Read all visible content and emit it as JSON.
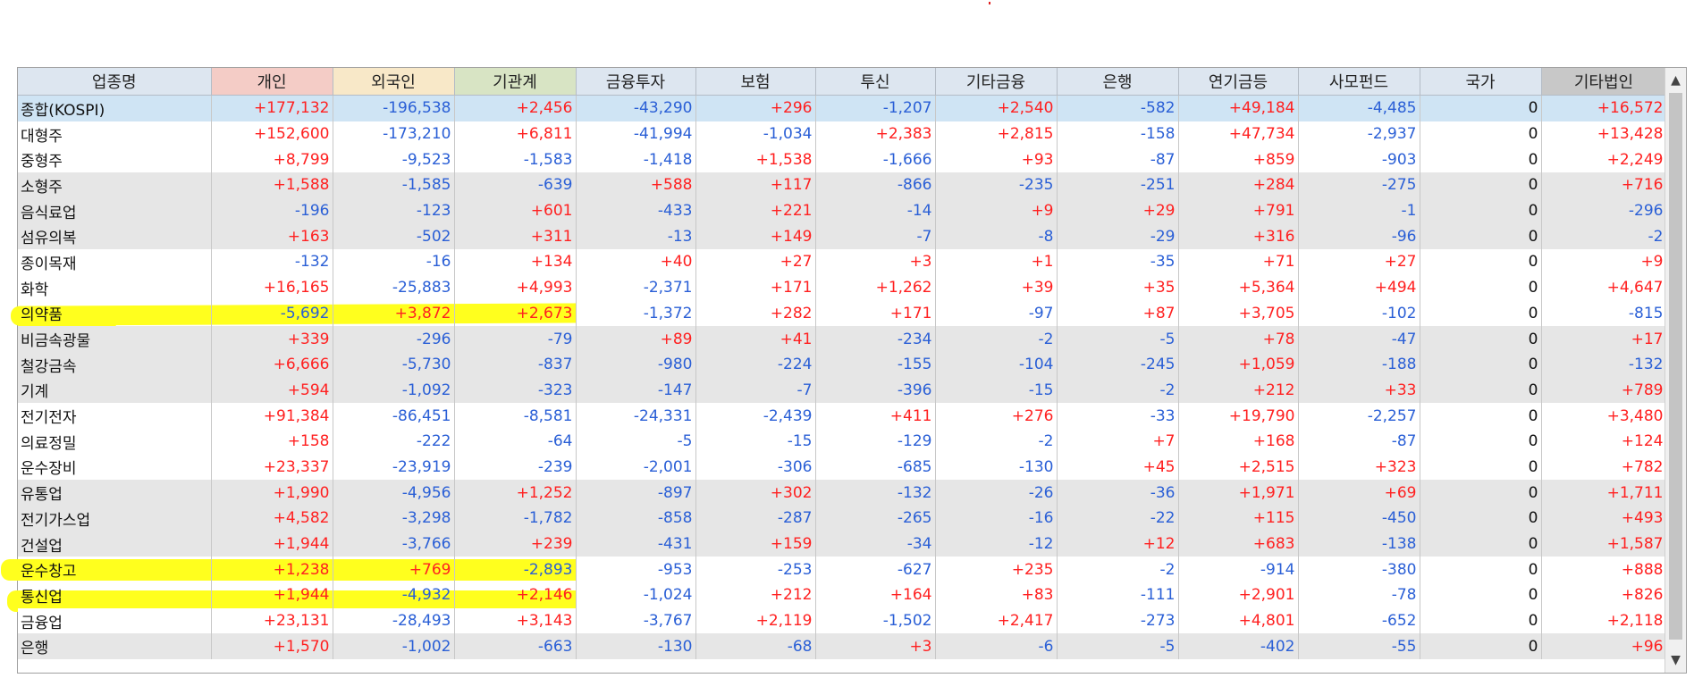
{
  "headers": [
    "업종명",
    "개인",
    "외국인",
    "기관계",
    "금융투자",
    "보험",
    "투신",
    "기타금융",
    "은행",
    "연기금등",
    "사모펀드",
    "국가",
    "기타법인"
  ],
  "header_colors": [
    "#dde6f0",
    "#f4ccc6",
    "#f8e8c8",
    "#d8e4c4",
    "#dde6f0",
    "#dde6f0",
    "#dde6f0",
    "#dde6f0",
    "#dde6f0",
    "#dde6f0",
    "#dde6f0",
    "#dde6f0",
    "#c8c8c8"
  ],
  "rows": [
    {
      "name": "종합(KOSPI)",
      "values": [
        "+177,132",
        "-196,538",
        "+2,456",
        "-43,290",
        "+296",
        "-1,207",
        "+2,540",
        "-582",
        "+49,184",
        "-4,485",
        "0",
        "+16,572"
      ]
    },
    {
      "name": "대형주",
      "values": [
        "+152,600",
        "-173,210",
        "+6,811",
        "-41,994",
        "-1,034",
        "+2,383",
        "+2,815",
        "-158",
        "+47,734",
        "-2,937",
        "0",
        "+13,428"
      ]
    },
    {
      "name": "중형주",
      "values": [
        "+8,799",
        "-9,523",
        "-1,583",
        "-1,418",
        "+1,538",
        "-1,666",
        "+93",
        "-87",
        "+859",
        "-903",
        "0",
        "+2,249"
      ]
    },
    {
      "name": "소형주",
      "values": [
        "+1,588",
        "-1,585",
        "-639",
        "+588",
        "+117",
        "-866",
        "-235",
        "-251",
        "+284",
        "-275",
        "0",
        "+716"
      ]
    },
    {
      "name": "음식료업",
      "values": [
        "-196",
        "-123",
        "+601",
        "-433",
        "+221",
        "-14",
        "+9",
        "+29",
        "+791",
        "-1",
        "0",
        "-296"
      ]
    },
    {
      "name": "섬유의복",
      "values": [
        "+163",
        "-502",
        "+311",
        "-13",
        "+149",
        "-7",
        "-8",
        "-29",
        "+316",
        "-96",
        "0",
        "-2"
      ]
    },
    {
      "name": "종이목재",
      "values": [
        "-132",
        "-16",
        "+134",
        "+40",
        "+27",
        "+3",
        "+1",
        "-35",
        "+71",
        "+27",
        "0",
        "+9"
      ]
    },
    {
      "name": "화학",
      "values": [
        "+16,165",
        "-25,883",
        "+4,993",
        "-2,371",
        "+171",
        "+1,262",
        "+39",
        "+35",
        "+5,364",
        "+494",
        "0",
        "+4,647"
      ]
    },
    {
      "name": "의약품",
      "values": [
        "-5,692",
        "+3,872",
        "+2,673",
        "-1,372",
        "+282",
        "+171",
        "-97",
        "+87",
        "+3,705",
        "-102",
        "0",
        "-815"
      ]
    },
    {
      "name": "비금속광물",
      "values": [
        "+339",
        "-296",
        "-79",
        "+89",
        "+41",
        "-234",
        "-2",
        "-5",
        "+78",
        "-47",
        "0",
        "+17"
      ]
    },
    {
      "name": "철강금속",
      "values": [
        "+6,666",
        "-5,730",
        "-837",
        "-980",
        "-224",
        "-155",
        "-104",
        "-245",
        "+1,059",
        "-188",
        "0",
        "-132"
      ]
    },
    {
      "name": "기계",
      "values": [
        "+594",
        "-1,092",
        "-323",
        "-147",
        "-7",
        "-396",
        "-15",
        "-2",
        "+212",
        "+33",
        "0",
        "+789"
      ]
    },
    {
      "name": "전기전자",
      "values": [
        "+91,384",
        "-86,451",
        "-8,581",
        "-24,331",
        "-2,439",
        "+411",
        "+276",
        "-33",
        "+19,790",
        "-2,257",
        "0",
        "+3,480"
      ]
    },
    {
      "name": "의료정밀",
      "values": [
        "+158",
        "-222",
        "-64",
        "-5",
        "-15",
        "-129",
        "-2",
        "+7",
        "+168",
        "-87",
        "0",
        "+124"
      ]
    },
    {
      "name": "운수장비",
      "values": [
        "+23,337",
        "-23,919",
        "-239",
        "-2,001",
        "-306",
        "-685",
        "-130",
        "+45",
        "+2,515",
        "+323",
        "0",
        "+782"
      ]
    },
    {
      "name": "유통업",
      "values": [
        "+1,990",
        "-4,956",
        "+1,252",
        "-897",
        "+302",
        "-132",
        "-26",
        "-36",
        "+1,971",
        "+69",
        "0",
        "+1,711"
      ]
    },
    {
      "name": "전기가스업",
      "values": [
        "+4,582",
        "-3,298",
        "-1,782",
        "-858",
        "-287",
        "-265",
        "-16",
        "-22",
        "+115",
        "-450",
        "0",
        "+493"
      ]
    },
    {
      "name": "건설업",
      "values": [
        "+1,944",
        "-3,766",
        "+239",
        "-431",
        "+159",
        "-34",
        "-12",
        "+12",
        "+683",
        "-138",
        "0",
        "+1,587"
      ]
    },
    {
      "name": "운수창고",
      "values": [
        "+1,238",
        "+769",
        "-2,893",
        "-953",
        "-253",
        "-627",
        "+235",
        "-2",
        "-914",
        "-380",
        "0",
        "+888"
      ]
    },
    {
      "name": "통신업",
      "values": [
        "+1,944",
        "-4,932",
        "+2,146",
        "-1,024",
        "+212",
        "+164",
        "+83",
        "-111",
        "+2,901",
        "-78",
        "0",
        "+826"
      ]
    },
    {
      "name": "금융업",
      "values": [
        "+23,131",
        "-28,493",
        "+3,143",
        "-3,767",
        "+2,119",
        "-1,502",
        "+2,417",
        "-273",
        "+4,801",
        "-652",
        "0",
        "+2,118"
      ]
    },
    {
      "name": "은행",
      "values": [
        "+1,570",
        "-1,002",
        "-663",
        "-130",
        "-68",
        "+3",
        "-6",
        "-5",
        "-402",
        "-55",
        "0",
        "+96"
      ]
    }
  ],
  "row_styles": [
    "total",
    "plain",
    "plain",
    "shade",
    "shade",
    "shade",
    "plain",
    "plain",
    "plain",
    "shade",
    "shade",
    "shade",
    "plain",
    "plain",
    "plain",
    "shade",
    "shade",
    "shade",
    "plain",
    "plain",
    "plain",
    "shade"
  ],
  "highlighted_rows": [
    "의약품",
    "운수창고",
    "통신업"
  ],
  "highlight_color": "#ffff1e",
  "scrollbar": {
    "up_icon": "▲",
    "down_icon": "▼"
  }
}
